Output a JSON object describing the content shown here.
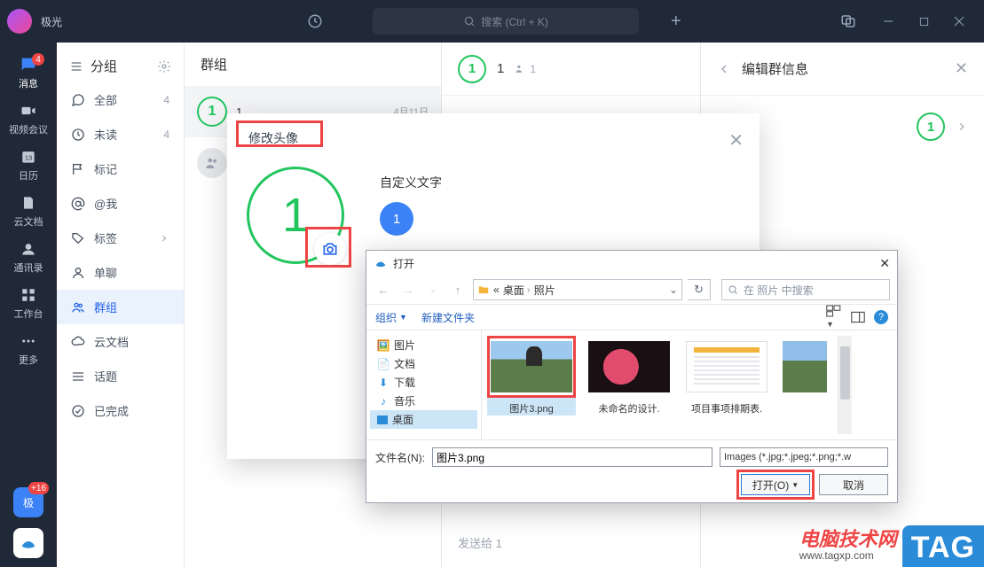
{
  "app": {
    "name": "极光"
  },
  "topbar": {
    "search_placeholder": "搜索 (Ctrl + K)"
  },
  "leftrail": {
    "items": [
      {
        "label": "消息",
        "icon": "chat",
        "badge": "4"
      },
      {
        "label": "视频会议",
        "icon": "video"
      },
      {
        "label": "日历",
        "icon": "calendar"
      },
      {
        "label": "云文档",
        "icon": "cloud-doc"
      },
      {
        "label": "通讯录",
        "icon": "contacts"
      },
      {
        "label": "工作台",
        "icon": "apps"
      },
      {
        "label": "更多",
        "icon": "more"
      }
    ],
    "bottom_badge": "+16",
    "bottom_label": "极"
  },
  "sidebar": {
    "header": "分组",
    "items": [
      {
        "icon": "all",
        "label": "全部",
        "count": "4"
      },
      {
        "icon": "clock",
        "label": "未读",
        "count": "4"
      },
      {
        "icon": "flag",
        "label": "标记",
        "count": ""
      },
      {
        "icon": "at",
        "label": "@我",
        "count": ""
      },
      {
        "icon": "tag",
        "label": "标签",
        "count": ""
      },
      {
        "icon": "single",
        "label": "单聊",
        "count": ""
      },
      {
        "icon": "group",
        "label": "群组",
        "count": ""
      },
      {
        "icon": "cloud",
        "label": "云文档",
        "count": ""
      },
      {
        "icon": "topic",
        "label": "话题",
        "count": ""
      },
      {
        "icon": "done",
        "label": "已完成",
        "count": ""
      }
    ]
  },
  "grouplist": {
    "title": "群组",
    "rows": [
      {
        "name": "1",
        "date": "4月11日",
        "avatar": "green"
      },
      {
        "name": "",
        "date": "",
        "avatar": "grey"
      }
    ]
  },
  "chat": {
    "title": "1",
    "member_count": "1",
    "footer": "发送给 1"
  },
  "panel": {
    "title": "编辑群信息",
    "row1_text": "1"
  },
  "modal": {
    "title": "修改头像",
    "custom_text_label": "自定义文字",
    "avatar_letter": "1",
    "blue_circle_text": "1"
  },
  "filedlg": {
    "title": "打开",
    "path_seg1": "桌面",
    "path_seg2": "照片",
    "path_prefix": "«",
    "search_placeholder": "在 照片 中搜索",
    "toolbar_org": "组织",
    "toolbar_new": "新建文件夹",
    "tree": [
      {
        "icon": "pic",
        "label": "图片"
      },
      {
        "icon": "doc",
        "label": "文档"
      },
      {
        "icon": "dl",
        "label": "下载"
      },
      {
        "icon": "music",
        "label": "音乐"
      },
      {
        "icon": "desk",
        "label": "桌面"
      }
    ],
    "files": [
      {
        "name": "图片3.png",
        "thumb": "kiki",
        "selected": true
      },
      {
        "name": "未命名的设计.",
        "thumb": "flower",
        "selected": false
      },
      {
        "name": "项目事项排期表.",
        "thumb": "doc",
        "selected": false
      },
      {
        "name": "",
        "thumb": "kiki2",
        "selected": false
      }
    ],
    "filename_label": "文件名(N):",
    "filename_value": "图片3.png",
    "filter": "Images (*.jpg;*.jpeg;*.png;*.w",
    "btn_open": "打开(O)",
    "btn_cancel": "取消"
  },
  "watermark": {
    "line1": "电脑技术网",
    "line2": "www.tagxp.com",
    "tag": "TAG"
  }
}
